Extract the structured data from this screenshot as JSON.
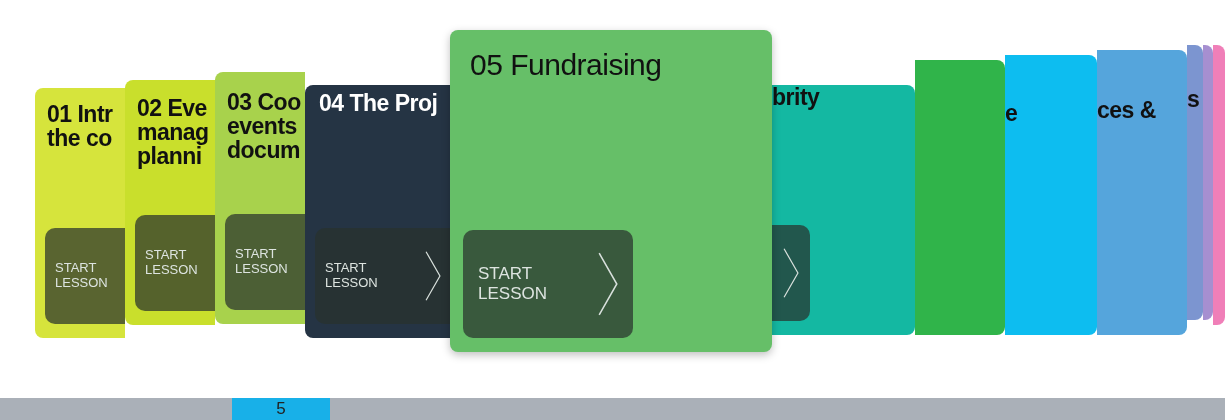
{
  "lessons": [
    {
      "title": [
        "01 Intr",
        "the co"
      ],
      "color": "#d6e43c",
      "selected": false,
      "button": "START\nLESSON",
      "chevron": false
    },
    {
      "title": [
        "02 Eve",
        "manag",
        "planni"
      ],
      "color": "#c9df2c",
      "selected": false,
      "button": "START\nLESSON",
      "chevron": false
    },
    {
      "title": [
        "03 Coo",
        "events",
        "docum"
      ],
      "color": "#a8d24c",
      "selected": false,
      "button": "START\nLESSON",
      "chevron": false
    },
    {
      "title": [
        "04 The Proj"
      ],
      "color": "#253444",
      "selected": false,
      "button": "START\nLESSON",
      "chevron": true
    },
    {
      "title": [
        "05 Fundraising"
      ],
      "color": "#66bf68",
      "selected": true,
      "button": "START\nLESSON",
      "chevron": true
    },
    {
      "title": [
        "brity"
      ],
      "color": "#14b8a2",
      "selected": false,
      "chevron": true
    },
    {
      "color": "#30b44a",
      "selected": false
    },
    {
      "title": [
        "e"
      ],
      "color": "#0dbdf0",
      "selected": false
    },
    {
      "title": [
        "ces &"
      ],
      "color": "#55a5dc",
      "selected": false
    },
    {
      "title": [
        "s"
      ],
      "color": "#7c95d0",
      "selected": false
    },
    {
      "color": "#a68fd0",
      "selected": false
    },
    {
      "color": "#f07fb8",
      "selected": false
    }
  ],
  "pager": {
    "current": "5"
  }
}
